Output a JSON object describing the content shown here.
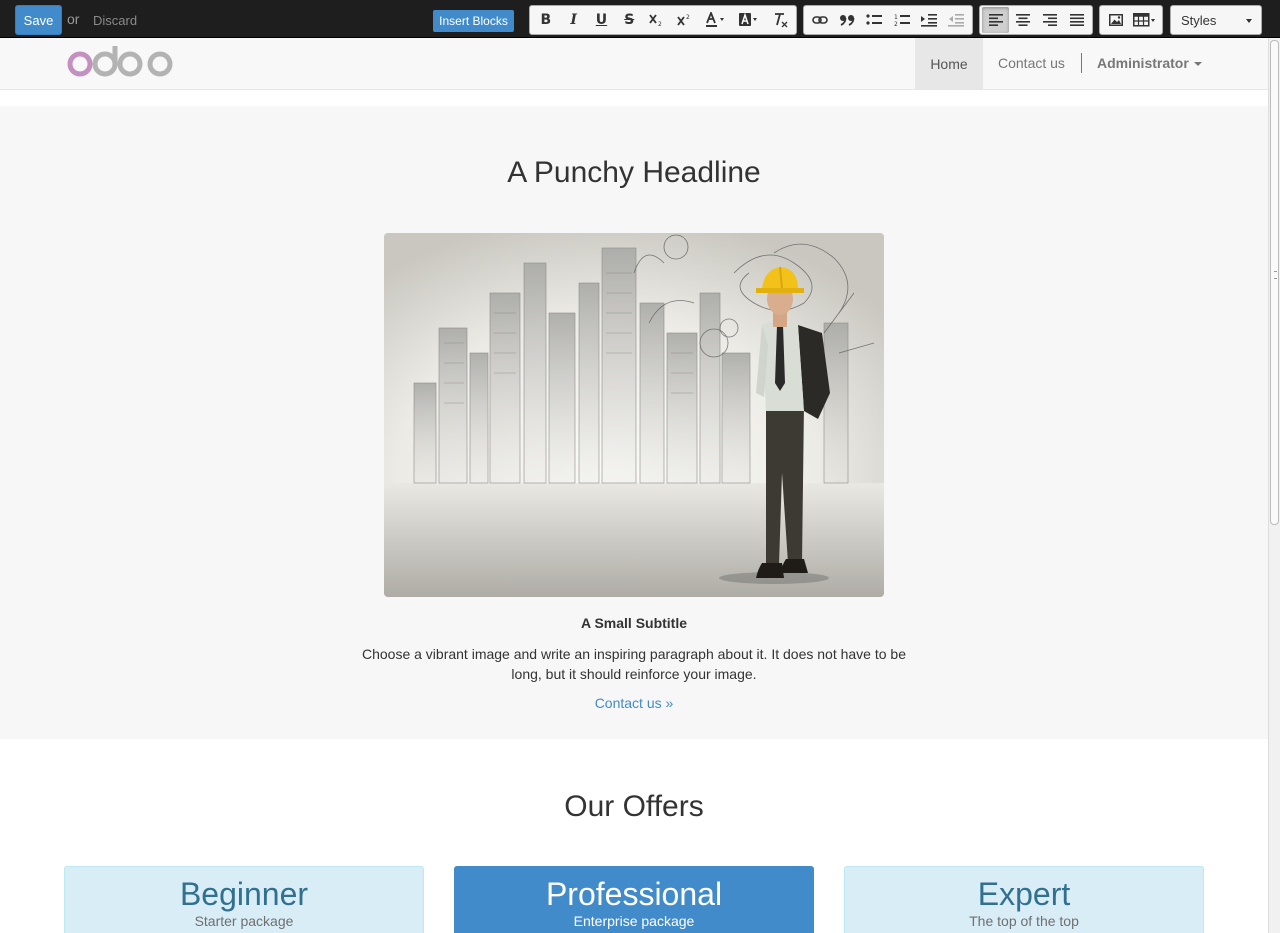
{
  "editor": {
    "save_label": "Save",
    "or_label": "or",
    "discard_label": "Discard",
    "insert_blocks_label": "Insert Blocks",
    "styles_label": "Styles",
    "tools": {
      "bold": "B",
      "italic": "I",
      "underline": "U",
      "strike": "S"
    }
  },
  "nav": {
    "items": [
      {
        "label": "Home",
        "active": true
      },
      {
        "label": "Contact us",
        "active": false
      }
    ],
    "user_label": "Administrator"
  },
  "hero": {
    "title": "A Punchy Headline",
    "subtitle": "A Small Subtitle",
    "paragraph": "Choose a vibrant image and write an inspiring paragraph about it. It does not have to be long, but it should reinforce your image.",
    "link_label": "Contact us »"
  },
  "offers": {
    "title": "Our Offers",
    "items": [
      {
        "title": "Beginner",
        "subtitle": "Starter package"
      },
      {
        "title": "Professional",
        "subtitle": "Enterprise package"
      },
      {
        "title": "Expert",
        "subtitle": "The top of the top"
      }
    ]
  },
  "colors": {
    "primary": "#428bca",
    "toolbar_bg": "#1e1e1e",
    "navbar_bg": "#f8f8f8",
    "hero_bg": "#f7f7f7",
    "offer_info_bg": "#d9edf7",
    "logo_purple": "#c490c0",
    "logo_grey": "#b3b3b3"
  }
}
